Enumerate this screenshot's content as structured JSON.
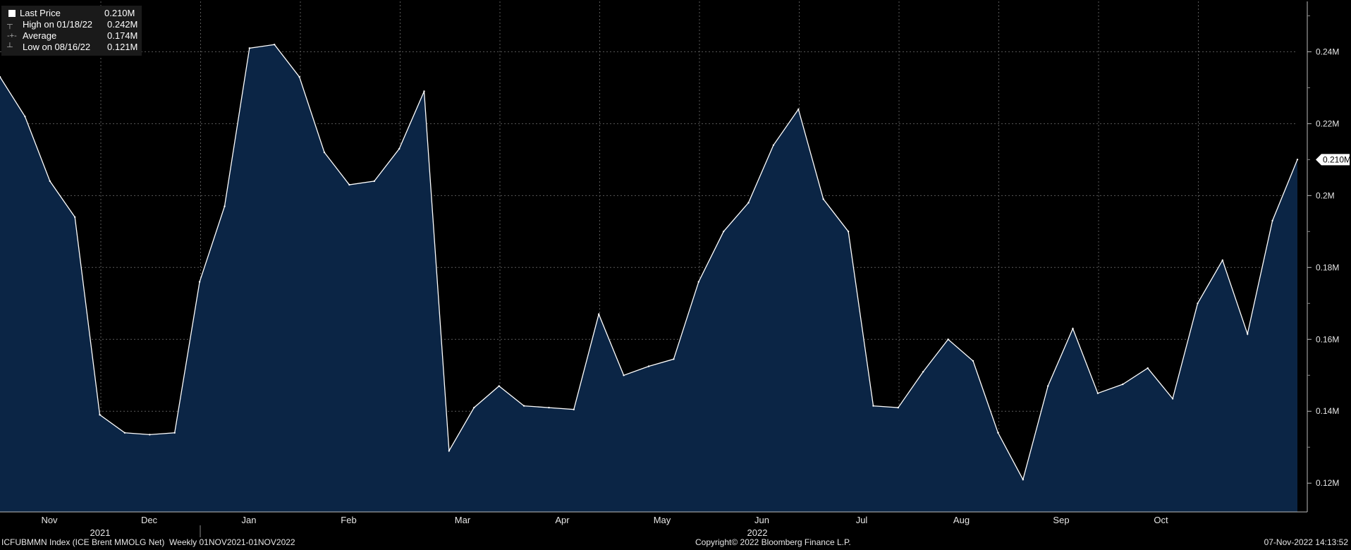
{
  "chart_data": {
    "type": "area",
    "title": "",
    "ticker": "ICFUBMMN Index (ICE Brent MMOLG Net)",
    "period": "Weekly 01NOV2021-01NOV2022",
    "ylim": [
      0.112,
      0.254
    ],
    "y_ticks": [
      {
        "value": 0.12,
        "label": "0.12M"
      },
      {
        "value": 0.14,
        "label": "0.14M"
      },
      {
        "value": 0.16,
        "label": "0.16M"
      },
      {
        "value": 0.18,
        "label": "0.18M"
      },
      {
        "value": 0.2,
        "label": "0.2M"
      },
      {
        "value": 0.22,
        "label": "0.22M"
      },
      {
        "value": 0.24,
        "label": "0.24M"
      }
    ],
    "month_labels": [
      "Nov",
      "Dec",
      "Jan",
      "Feb",
      "Mar",
      "Apr",
      "May",
      "Jun",
      "Jul",
      "Aug",
      "Sep",
      "Oct"
    ],
    "year_labels": [
      "2021",
      "2022"
    ],
    "series": [
      {
        "values": [
          0.233,
          0.222,
          0.204,
          0.194,
          0.139,
          0.134,
          0.1335,
          0.134,
          0.176,
          0.197,
          0.241,
          0.242,
          0.233,
          0.212,
          0.203,
          0.204,
          0.213,
          0.229,
          0.129,
          0.141,
          0.147,
          0.1415,
          0.141,
          0.1405,
          0.167,
          0.15,
          0.1525,
          0.1545,
          0.176,
          0.19,
          0.198,
          0.214,
          0.224,
          0.199,
          0.19,
          0.1415,
          0.141,
          0.151,
          0.16,
          0.154,
          0.134,
          0.121,
          0.147,
          0.163,
          0.145,
          0.1475,
          0.152,
          0.1435,
          0.17,
          0.182,
          0.1615,
          0.193,
          0.21
        ],
        "color": "#ffffff",
        "fill": "#0b2545"
      }
    ],
    "last_price_tag": "0.210M",
    "legend": {
      "position": "top-left",
      "items": [
        {
          "glyph": "swatch",
          "label": "Last Price",
          "value": "0.210M"
        },
        {
          "glyph": "high",
          "label": "High on 01/18/22",
          "value": "0.242M"
        },
        {
          "glyph": "avg",
          "label": "Average",
          "value": "0.174M"
        },
        {
          "glyph": "low",
          "label": "Low on 08/16/22",
          "value": "0.121M"
        }
      ]
    },
    "copyright": "Copyright© 2022 Bloomberg Finance L.P.",
    "timestamp": "07-Nov-2022 14:13:52",
    "colors": {
      "background": "#000000",
      "grid": "#5a5a5a",
      "line": "#ffffff",
      "fill": "#0b2545"
    }
  }
}
